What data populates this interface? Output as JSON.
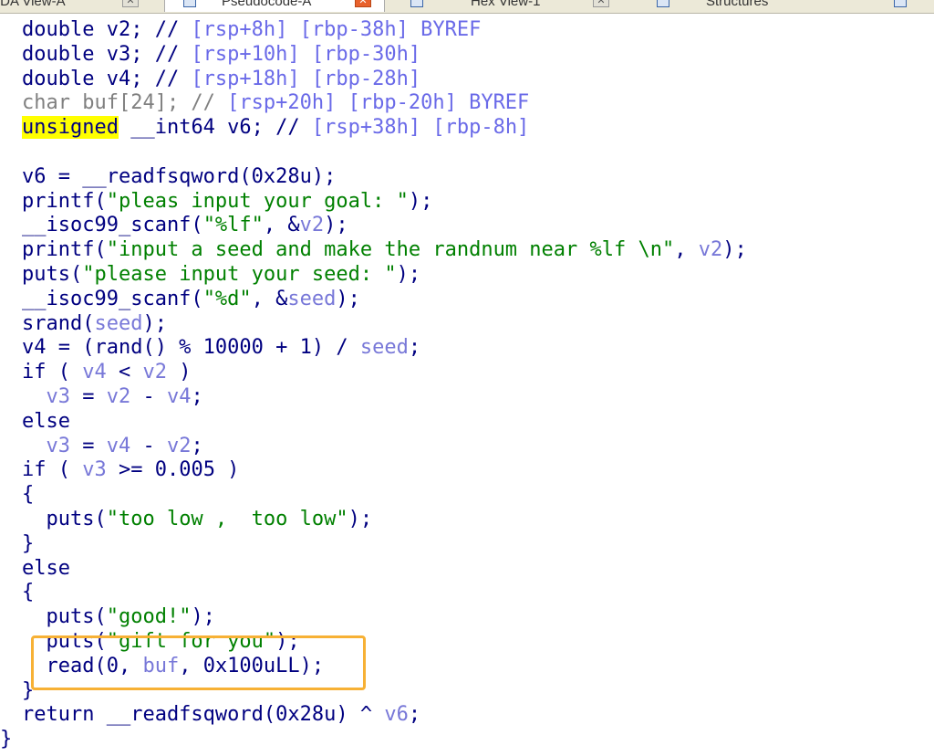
{
  "tabs": [
    {
      "label": "IDA View-A",
      "active": false
    },
    {
      "label": "Pseudocode-A",
      "active": true
    },
    {
      "label": "Hex View-1",
      "active": false
    },
    {
      "label": "Structures",
      "active": false
    }
  ],
  "colors": {
    "text": "#000080",
    "string": "#008000",
    "variable": "#7878d8",
    "highlight": "#ffff00",
    "box": "#f7b135"
  },
  "code_lines": [
    [
      {
        "t": "double v2; // ",
        "c": "n"
      },
      {
        "t": "[rsp+8h] [rbp-38h] BYREF",
        "c": "c"
      }
    ],
    [
      {
        "t": "double v3; // ",
        "c": "n"
      },
      {
        "t": "[rsp+10h] [rbp-30h]",
        "c": "c"
      }
    ],
    [
      {
        "t": "double v4; // ",
        "c": "n"
      },
      {
        "t": "[rsp+18h] [rbp-28h]",
        "c": "c"
      }
    ],
    [
      {
        "t": "char buf[24]; // ",
        "c": "g"
      },
      {
        "t": "[rsp+20h] [rbp-20h] BYREF",
        "c": "c"
      }
    ],
    [
      {
        "t": "unsigned",
        "c": "hl"
      },
      {
        "t": " __int64 v6; // ",
        "c": "n"
      },
      {
        "t": "[rsp+38h] [rbp-8h]",
        "c": "c"
      }
    ],
    [],
    [
      {
        "t": "v6 = __readfsqword(0x28u);",
        "c": "n"
      }
    ],
    [
      {
        "t": "printf(",
        "c": "n"
      },
      {
        "t": "\"pleas input your goal: \"",
        "c": "s"
      },
      {
        "t": ");",
        "c": "n"
      }
    ],
    [
      {
        "t": "__isoc99_scanf(",
        "c": "n"
      },
      {
        "t": "\"%lf\"",
        "c": "s"
      },
      {
        "t": ", &",
        "c": "n"
      },
      {
        "t": "v2",
        "c": "v"
      },
      {
        "t": ");",
        "c": "n"
      }
    ],
    [
      {
        "t": "printf(",
        "c": "n"
      },
      {
        "t": "\"input a seed and make the randnum near %lf \\n\"",
        "c": "s"
      },
      {
        "t": ", ",
        "c": "n"
      },
      {
        "t": "v2",
        "c": "v"
      },
      {
        "t": ");",
        "c": "n"
      }
    ],
    [
      {
        "t": "puts(",
        "c": "n"
      },
      {
        "t": "\"please input your seed: \"",
        "c": "s"
      },
      {
        "t": ");",
        "c": "n"
      }
    ],
    [
      {
        "t": "__isoc99_scanf(",
        "c": "n"
      },
      {
        "t": "\"%d\"",
        "c": "s"
      },
      {
        "t": ", &",
        "c": "n"
      },
      {
        "t": "seed",
        "c": "v"
      },
      {
        "t": ");",
        "c": "n"
      }
    ],
    [
      {
        "t": "srand(",
        "c": "n"
      },
      {
        "t": "seed",
        "c": "v"
      },
      {
        "t": ");",
        "c": "n"
      }
    ],
    [
      {
        "t": "v4 = (rand() % 10000 + 1) / ",
        "c": "n"
      },
      {
        "t": "seed",
        "c": "v"
      },
      {
        "t": ";",
        "c": "n"
      }
    ],
    [
      {
        "t": "if ( ",
        "c": "n"
      },
      {
        "t": "v4",
        "c": "v"
      },
      {
        "t": " < ",
        "c": "n"
      },
      {
        "t": "v2",
        "c": "v"
      },
      {
        "t": " )",
        "c": "n"
      }
    ],
    [
      {
        "t": "  ",
        "c": "n"
      },
      {
        "t": "v3",
        "c": "v"
      },
      {
        "t": " = ",
        "c": "n"
      },
      {
        "t": "v2",
        "c": "v"
      },
      {
        "t": " - ",
        "c": "n"
      },
      {
        "t": "v4",
        "c": "v"
      },
      {
        "t": ";",
        "c": "n"
      }
    ],
    [
      {
        "t": "else",
        "c": "n"
      }
    ],
    [
      {
        "t": "  ",
        "c": "n"
      },
      {
        "t": "v3",
        "c": "v"
      },
      {
        "t": " = ",
        "c": "n"
      },
      {
        "t": "v4",
        "c": "v"
      },
      {
        "t": " - ",
        "c": "n"
      },
      {
        "t": "v2",
        "c": "v"
      },
      {
        "t": ";",
        "c": "n"
      }
    ],
    [
      {
        "t": "if ( ",
        "c": "n"
      },
      {
        "t": "v3",
        "c": "v"
      },
      {
        "t": " >= 0.005 )",
        "c": "n"
      }
    ],
    [
      {
        "t": "{",
        "c": "n"
      }
    ],
    [
      {
        "t": "  puts(",
        "c": "n"
      },
      {
        "t": "\"too low ,  too low\"",
        "c": "s"
      },
      {
        "t": ");",
        "c": "n"
      }
    ],
    [
      {
        "t": "}",
        "c": "n"
      }
    ],
    [
      {
        "t": "else",
        "c": "n"
      }
    ],
    [
      {
        "t": "{",
        "c": "n"
      }
    ],
    [
      {
        "t": "  puts(",
        "c": "n"
      },
      {
        "t": "\"good!\"",
        "c": "s"
      },
      {
        "t": ");",
        "c": "n"
      }
    ],
    [
      {
        "t": "  puts(",
        "c": "n"
      },
      {
        "t": "\"gift for you\"",
        "c": "s"
      },
      {
        "t": ");",
        "c": "n"
      }
    ],
    [
      {
        "t": "  read(0, ",
        "c": "n"
      },
      {
        "t": "buf",
        "c": "v"
      },
      {
        "t": ", 0x100uLL);",
        "c": "n"
      }
    ],
    [
      {
        "t": "}",
        "c": "n"
      }
    ],
    [
      {
        "t": "return __readfsqword(0x28u) ^ ",
        "c": "n"
      },
      {
        "t": "v6",
        "c": "v"
      },
      {
        "t": ";",
        "c": "n"
      }
    ],
    [
      {
        "t": "}",
        "c": "n"
      }
    ]
  ]
}
